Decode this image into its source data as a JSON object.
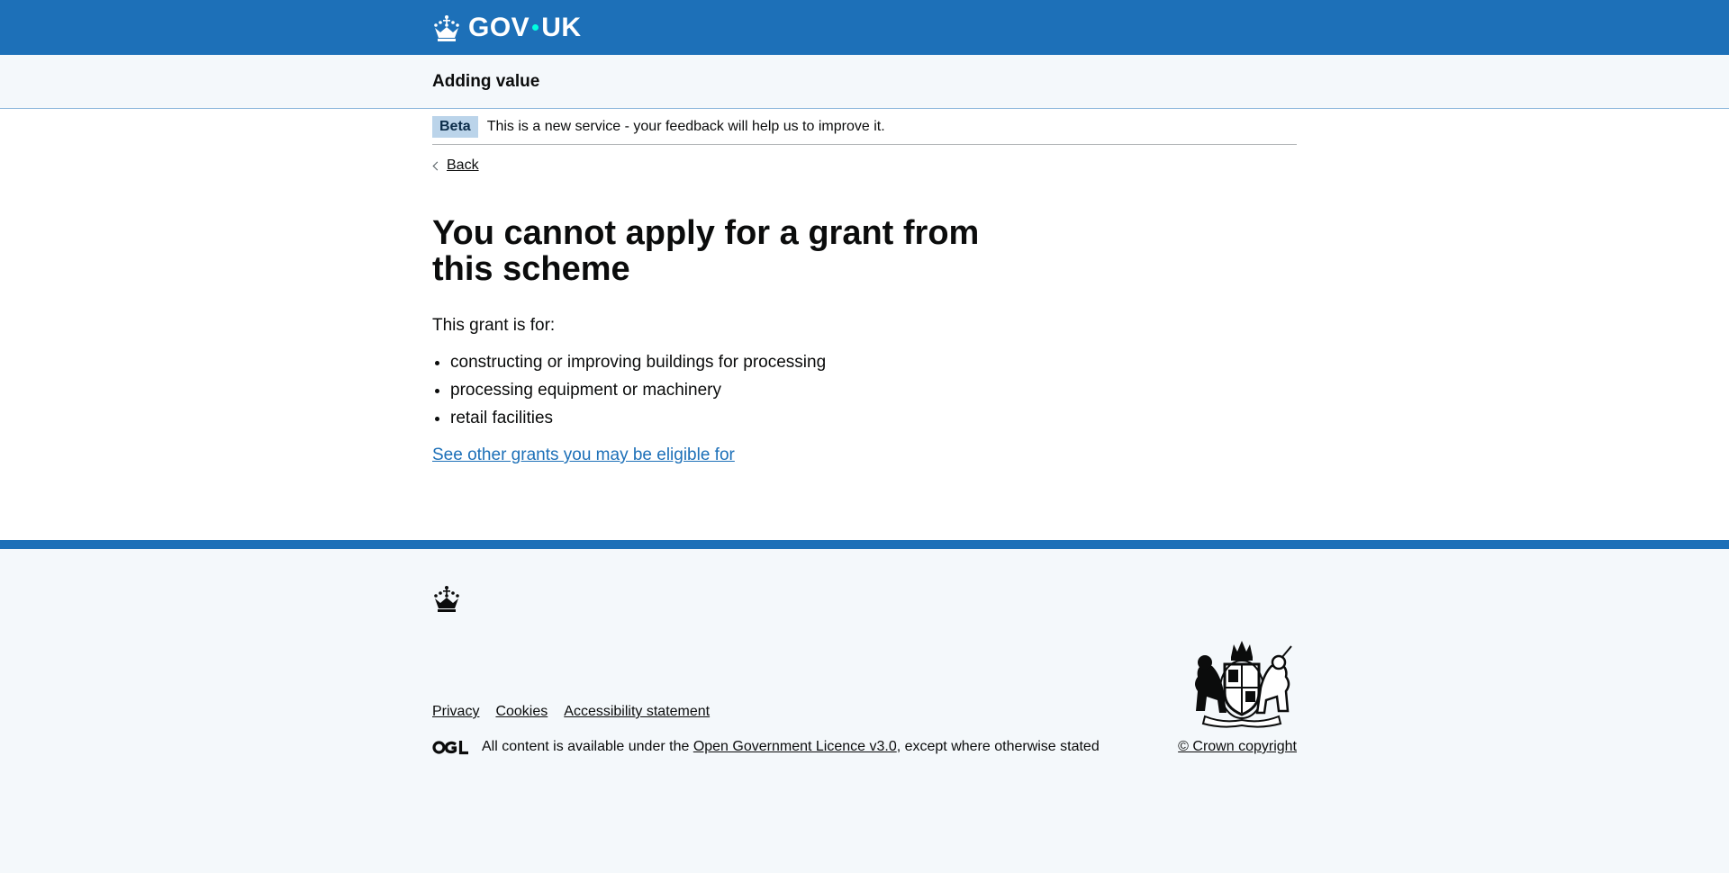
{
  "header": {
    "logo_text_left": "GOV",
    "logo_text_right": "UK",
    "crown_icon": "crown-icon"
  },
  "service": {
    "name": "Adding value"
  },
  "phase_banner": {
    "tag": "Beta",
    "text": "This is a new service - your feedback will help us to improve it."
  },
  "back": {
    "label": "Back"
  },
  "main": {
    "title": "You cannot apply for a grant from this scheme",
    "lead": "This grant is for:",
    "items": [
      "constructing or improving buildings for processing",
      "processing equipment or machinery",
      "retail facilities"
    ],
    "link_label": "See other grants you may be eligible for"
  },
  "footer": {
    "links": [
      "Privacy",
      "Cookies",
      "Accessibility statement"
    ],
    "licence_prefix": "All content is available under the ",
    "licence_link": "Open Government Licence v3.0",
    "licence_suffix": ", except where otherwise stated",
    "copyright": "© Crown copyright",
    "icons": [
      "crown-icon",
      "ogl-logo-icon",
      "royal-coat-of-arms-icon"
    ]
  },
  "colors": {
    "brand_blue": "#1d70b8",
    "link_blue": "#1d70b8",
    "text": "#0b0c0c",
    "footer_bg": "#f4f8fb",
    "beta_tag_bg": "#bbd4ea",
    "logo_dot": "#00ffe0"
  }
}
